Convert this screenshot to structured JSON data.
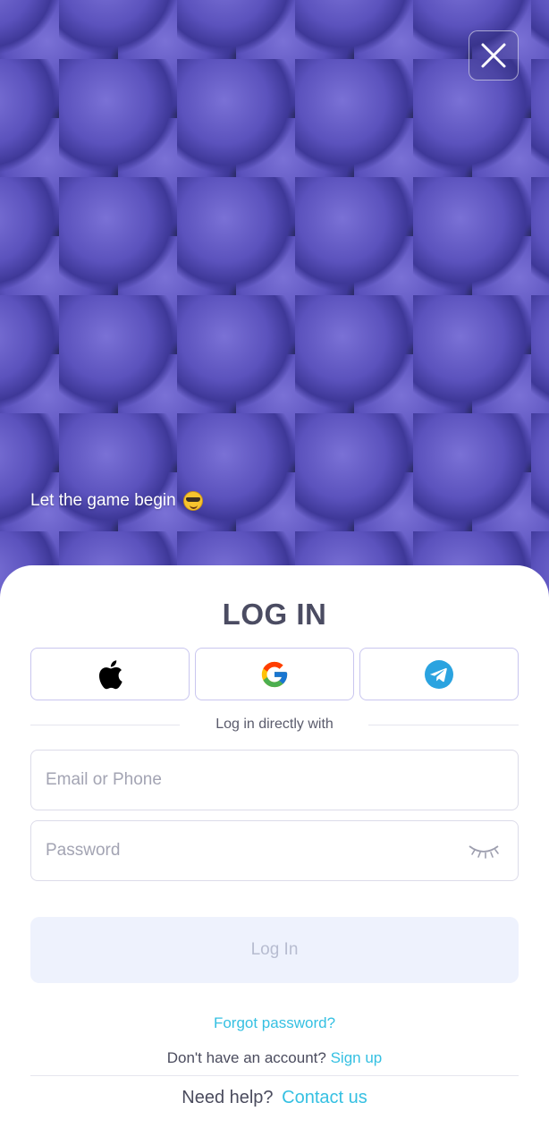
{
  "header": {
    "tagline": "Let the game begin",
    "tagline_emoji_icon": "smiling-face-with-sunglasses-icon",
    "close_icon": "close-icon"
  },
  "login": {
    "title": "LOG IN",
    "social_buttons": [
      {
        "icon": "apple-icon"
      },
      {
        "icon": "google-icon"
      },
      {
        "icon": "telegram-icon"
      }
    ],
    "divider_text": "Log in directly with",
    "email_placeholder": "Email or Phone",
    "password_placeholder": "Password",
    "password_toggle_icon": "eye-closed-icon",
    "submit_label": "Log In",
    "forgot_password": "Forgot password?",
    "no_account_text": "Don't have an account?",
    "signup_link": "Sign up",
    "help_text": "Need help?",
    "contact_link": "Contact us"
  },
  "colors": {
    "link": "#35c0e2",
    "title": "#4b4c62",
    "button_disabled_bg": "#eef2fd",
    "social_border": "#c9c6ef",
    "hero": "#5b52bd"
  }
}
